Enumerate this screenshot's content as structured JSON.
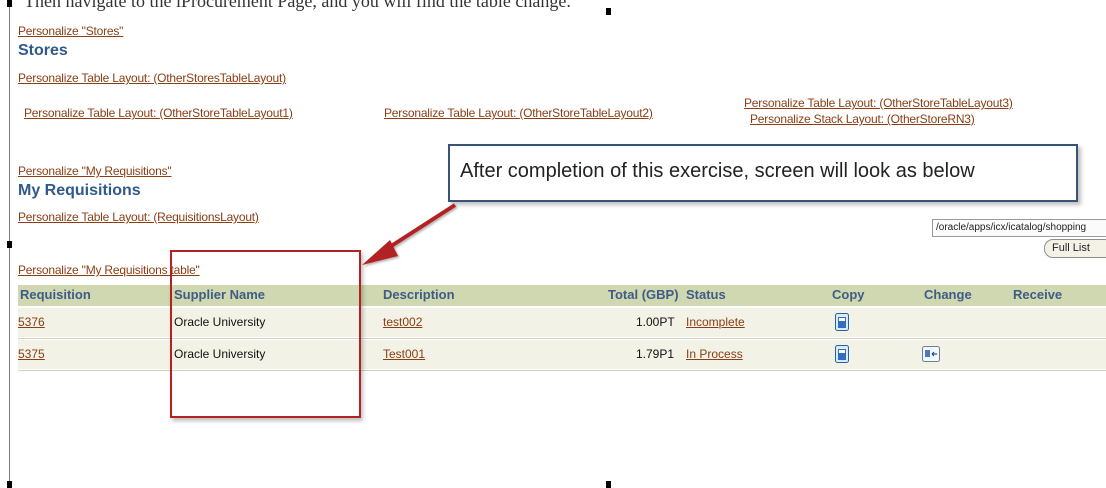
{
  "partial_heading": "Then navigate to the iProcurement Page, and you will find the table change.",
  "stores_section": {
    "personalize_link": "Personalize \"Stores\"",
    "title": "Stores",
    "table_layout_link": "Personalize Table Layout: (OtherStoresTableLayout)",
    "table_layout_1": "Personalize Table Layout: (OtherStoreTableLayout1)",
    "table_layout_2": "Personalize Table Layout: (OtherStoreTableLayout2)",
    "table_layout_3": "Personalize Table Layout: (OtherStoreTableLayout3)",
    "stack_layout": "Personalize Stack Layout: (OtherStoreRN3)"
  },
  "requisitions_section": {
    "personalize_link": "Personalize \"My Requisitions\"",
    "title": "My Requisitions",
    "table_layout_link": "Personalize Table Layout: (RequisitionsLayout)",
    "table_personalize_link": "Personalize \"My Requisitions table\""
  },
  "callout": {
    "text": "After completion of this exercise, screen will look as below",
    "border_color": "#3a5276"
  },
  "path_text": "/oracle/apps/icx/icatalog/shopping",
  "full_list_button": "Full List",
  "table": {
    "headers": [
      "Requisition",
      "Supplier Name",
      "Description",
      "Total (GBP)",
      "Status",
      "Copy",
      "Change",
      "Receive"
    ],
    "rows": [
      {
        "requisition": "5376",
        "supplier": "Oracle University",
        "description": "test002",
        "total": "1.00PT",
        "status": "Incomplete",
        "copy_icon": "copy-icon",
        "change_icon": ""
      },
      {
        "requisition": "5375",
        "supplier": "Oracle University",
        "description": "Test001",
        "total": "1.79P1",
        "status": "In Process",
        "copy_icon": "copy-icon",
        "change_icon": "change-icon"
      }
    ],
    "header_bg": "#cfd8b0",
    "row_bg": "#f3f2e6"
  },
  "colors": {
    "link": "#8a3e14",
    "section_title": "#2f5a8a",
    "highlight_box": "#b22222"
  }
}
